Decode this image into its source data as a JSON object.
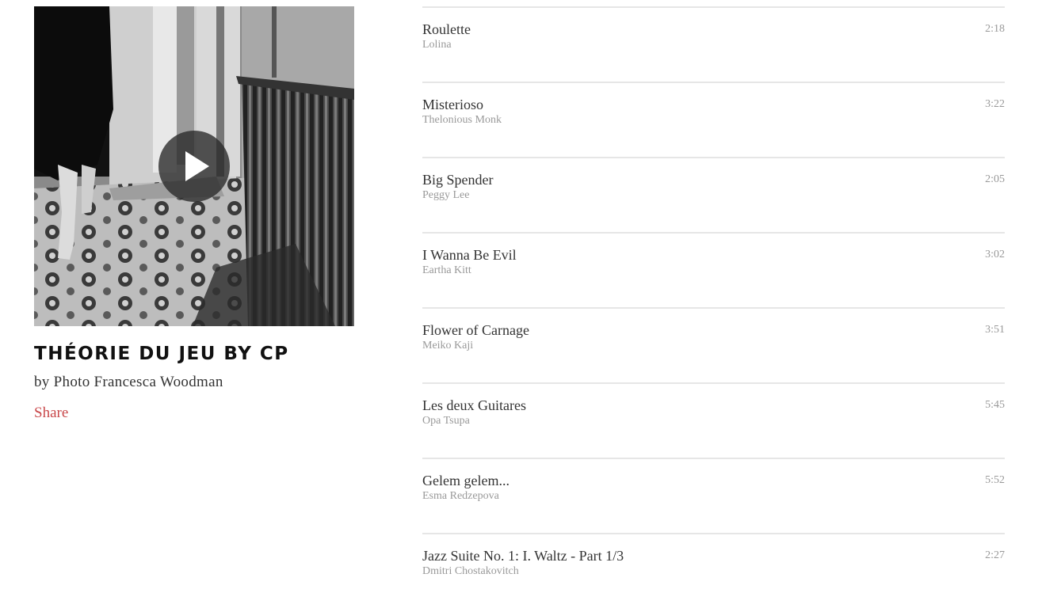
{
  "playlist": {
    "title": "THÉORIE DU JEU BY CP",
    "byline": "by Photo Francesca Woodman",
    "share_label": "Share",
    "play_icon": "play-icon",
    "share_color": "#c9484a"
  },
  "tracks": [
    {
      "title": "Roulette",
      "artist": "Lolina",
      "duration": "2:18"
    },
    {
      "title": "Misterioso",
      "artist": "Thelonious Monk",
      "duration": "3:22"
    },
    {
      "title": "Big Spender",
      "artist": "Peggy Lee",
      "duration": "2:05"
    },
    {
      "title": "I Wanna Be Evil",
      "artist": "Eartha Kitt",
      "duration": "3:02"
    },
    {
      "title": "Flower of Carnage",
      "artist": "Meiko Kaji",
      "duration": "3:51"
    },
    {
      "title": "Les deux Guitares",
      "artist": "Opa Tsupa",
      "duration": "5:45"
    },
    {
      "title": "Gelem gelem...",
      "artist": "Esma Redzepova",
      "duration": "5:52"
    },
    {
      "title": "Jazz Suite No. 1: I. Waltz - Part 1/3",
      "artist": "Dmitri Chostakovitch",
      "duration": "2:27"
    }
  ]
}
